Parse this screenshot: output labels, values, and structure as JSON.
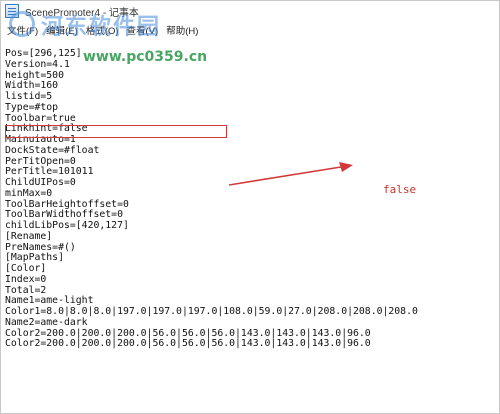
{
  "window": {
    "title": "ScenePromoter4 - 记事本"
  },
  "menu": {
    "items": [
      "文件(F)",
      "编辑(E)",
      "格式(O)",
      "查看(V)",
      "帮助(H)"
    ]
  },
  "watermark": {
    "text": "河东软件园",
    "url": "www.pc0359.cn"
  },
  "editor": {
    "lines": [
      "Pos=[296,125]",
      "Version=4.1",
      "height=500",
      "Width=160",
      "listid=5",
      "Type=#top",
      "Toolbar=true",
      "Linkhint=false",
      "Mainuiauto=1",
      "DockState=#float",
      "PerTitOpen=0",
      "PerTitle=101011",
      "ChildUIPos=0",
      "minMax=0",
      "ToolBarHeightoffset=0",
      "ToolBarWidthoffset=0",
      "childLibPos=[420,127]",
      "[Rename]",
      "PreNames=#()",
      "[MapPaths]",
      "[Color]",
      "Index=0",
      "Total=2",
      "Name1=ame-light",
      "Color1=8.0|8.0|8.0|197.0|197.0|197.0|108.0|59.0|27.0|208.0|208.0|208.0",
      "Name2=ame-dark",
      "Color2=200.0|200.0|200.0|56.0|56.0|56.0|143.0|143.0|143.0|96.0",
      "Color2=200.0|200.0|200.0|56.0|56.0|56.0|143.0|143.0|143.0|96.0"
    ]
  },
  "annotation": {
    "label": "false",
    "color": "#d23a3a"
  }
}
